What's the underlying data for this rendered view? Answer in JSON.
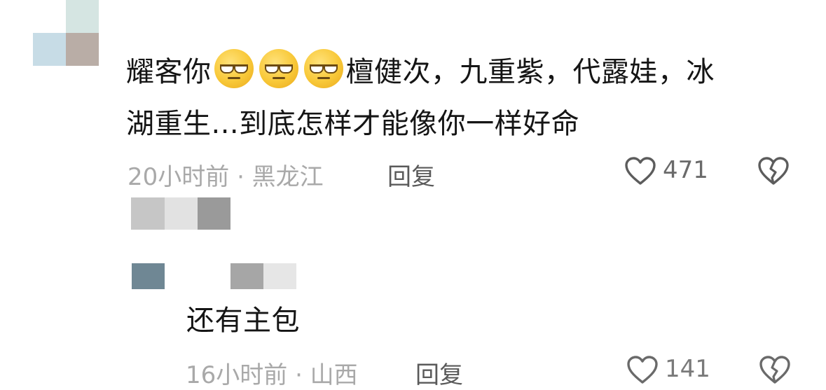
{
  "comment1": {
    "text_line1_before": "耀客你",
    "emoji_name": "unamused-emoji",
    "text_line1_after": "檀健次，九重紫，代露娃，冰",
    "text_line2": "湖重生...到底怎样才能像你一样好命",
    "meta": "20小时前 · 黑龙江",
    "reply_label": "回复",
    "like_count": "471"
  },
  "reply1": {
    "text": "还有主包",
    "meta": "16小时前 · 山西",
    "reply_label": "回复",
    "like_count": "141"
  },
  "colors": {
    "mosaic_light": "#e2e2e2",
    "mosaic_mid": "#c4c4c4",
    "mosaic_dark": "#9a9a9a",
    "avatar_blue": "#c7dce6",
    "avatar_brown": "#b9ada6",
    "avatar_slate": "#6f8794"
  }
}
